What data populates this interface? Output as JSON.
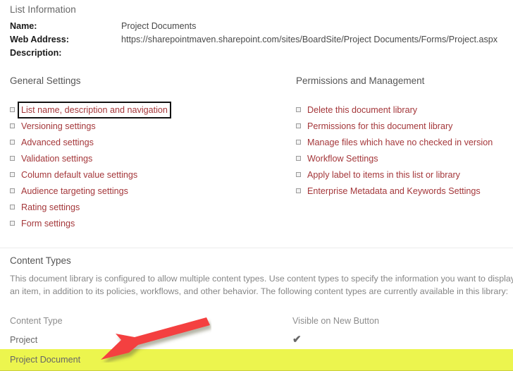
{
  "list_information": {
    "heading": "List Information",
    "fields": [
      {
        "label": "Name:",
        "value": "Project Documents"
      },
      {
        "label": "Web Address:",
        "value": "https://sharepointmaven.sharepoint.com/sites/BoardSite/Project Documents/Forms/Project.aspx"
      },
      {
        "label": "Description:",
        "value": ""
      }
    ]
  },
  "general_settings": {
    "heading": "General Settings",
    "items": [
      {
        "label": "List name, description and navigation",
        "focused": true
      },
      {
        "label": "Versioning settings",
        "focused": false
      },
      {
        "label": "Advanced settings",
        "focused": false
      },
      {
        "label": "Validation settings",
        "focused": false
      },
      {
        "label": "Column default value settings",
        "focused": false
      },
      {
        "label": "Audience targeting settings",
        "focused": false
      },
      {
        "label": "Rating settings",
        "focused": false
      },
      {
        "label": "Form settings",
        "focused": false
      }
    ]
  },
  "permissions_and_management": {
    "heading": "Permissions and Management",
    "items": [
      {
        "label": "Delete this document library"
      },
      {
        "label": "Permissions for this document library"
      },
      {
        "label": "Manage files which have no checked in version"
      },
      {
        "label": "Workflow Settings"
      },
      {
        "label": "Apply label to items in this list or library"
      },
      {
        "label": "Enterprise Metadata and Keywords Settings"
      }
    ]
  },
  "content_types": {
    "heading": "Content Types",
    "description": "This document library is configured to allow multiple content types. Use content types to specify the information you want to display about an item, in addition to its policies, workflows, and other behavior. The following content types are currently available in this library:",
    "columns": [
      "Content Type",
      "Visible on New Button"
    ],
    "rows": [
      {
        "content_type": "Project",
        "visible_on_new_button": "✔",
        "highlighted": false
      },
      {
        "content_type": "Project Document",
        "visible_on_new_button": "",
        "highlighted": true
      }
    ]
  },
  "annotation": {
    "arrow_color": "#f4413f",
    "arrow_target": "Project Document",
    "highlight_color": "#ecf54e"
  },
  "colors": {
    "link": "#a4373a",
    "heading": "#666666",
    "body_text": "#4a4a4a",
    "muted_text": "#868686",
    "highlight": "#ecf54e",
    "arrow": "#f4413f"
  }
}
